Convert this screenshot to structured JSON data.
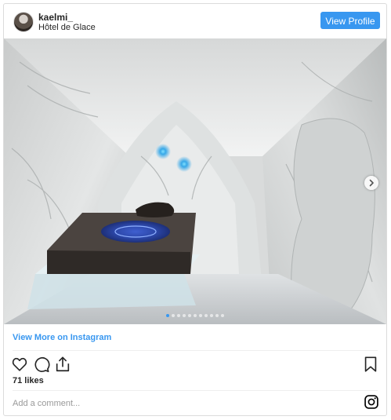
{
  "post": {
    "username": "kaelmi_",
    "location": "Hôtel de Glace",
    "view_profile_label": "View Profile",
    "view_more_label": "View More on Instagram",
    "likes": "71 likes",
    "comment_placeholder": "Add a comment...",
    "carousel_total": 11,
    "carousel_active_index": 0
  },
  "icons": {
    "like": "heart-icon",
    "comment": "comment-icon",
    "share": "share-icon",
    "save": "bookmark-icon",
    "next": "chevron-right-icon",
    "brand": "instagram-icon"
  },
  "colors": {
    "accent": "#3897f0",
    "text": "#262626",
    "placeholder": "#999999",
    "border": "#dbdbdb"
  }
}
